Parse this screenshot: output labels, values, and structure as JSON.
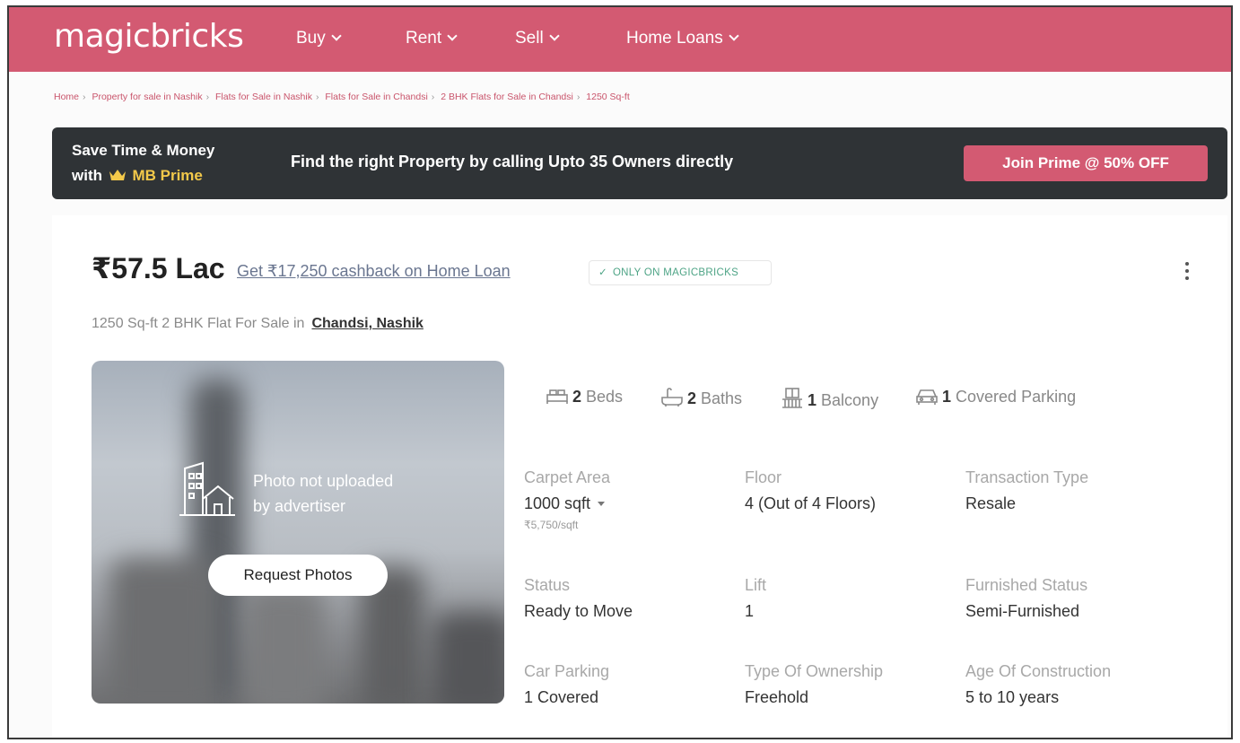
{
  "header": {
    "logo": "magicbricks",
    "nav": [
      {
        "label": "Buy"
      },
      {
        "label": "Rent"
      },
      {
        "label": "Sell"
      },
      {
        "label": "Home Loans"
      }
    ]
  },
  "breadcrumb": [
    "Home",
    "Property for sale in Nashik",
    "Flats for Sale in Nashik",
    "Flats for Sale in Chandsi",
    "2 BHK Flats for Sale in Chandsi",
    "1250 Sq-ft"
  ],
  "prime_banner": {
    "line1": "Save Time & Money",
    "with": "with",
    "brand": "MB Prime",
    "message": "Find the right Property by calling Upto 35 Owners directly",
    "cta": "Join Prime @ 50% OFF",
    "accent": "#f3c94a"
  },
  "listing": {
    "price": "₹57.5 Lac",
    "cashback": "Get ₹17,250 cashback on Home Loan",
    "badge": "ONLY ON MAGICBRICKS",
    "subtitle": "1250 Sq-ft 2 BHK Flat For Sale in",
    "location": "Chandsi, Nashik",
    "photo": {
      "message_line1": "Photo not uploaded",
      "message_line2": "by advertiser",
      "button": "Request Photos"
    },
    "amenities": [
      {
        "icon": "bed-icon",
        "count": "2",
        "label": "Beds"
      },
      {
        "icon": "bath-icon",
        "count": "2",
        "label": "Baths"
      },
      {
        "icon": "balcony-icon",
        "count": "1",
        "label": "Balcony"
      },
      {
        "icon": "car-icon",
        "count": "1",
        "label": "Covered Parking"
      }
    ],
    "details": [
      {
        "label": "Carpet Area",
        "value": "1000 sqft",
        "sub": "₹5,750/sqft"
      },
      {
        "label": "Floor",
        "value": "4 (Out of 4 Floors)"
      },
      {
        "label": "Transaction Type",
        "value": "Resale"
      },
      {
        "label": "Status",
        "value": "Ready to Move"
      },
      {
        "label": "Lift",
        "value": "1"
      },
      {
        "label": "Furnished Status",
        "value": "Semi-Furnished"
      },
      {
        "label": "Car Parking",
        "value": "1 Covered"
      },
      {
        "label": "Type Of Ownership",
        "value": "Freehold"
      },
      {
        "label": "Age Of Construction",
        "value": "5 to 10 years"
      }
    ]
  },
  "colors": {
    "brand": "#d35a72",
    "banner_bg": "#2f3336",
    "badge_green": "#4ea486"
  }
}
